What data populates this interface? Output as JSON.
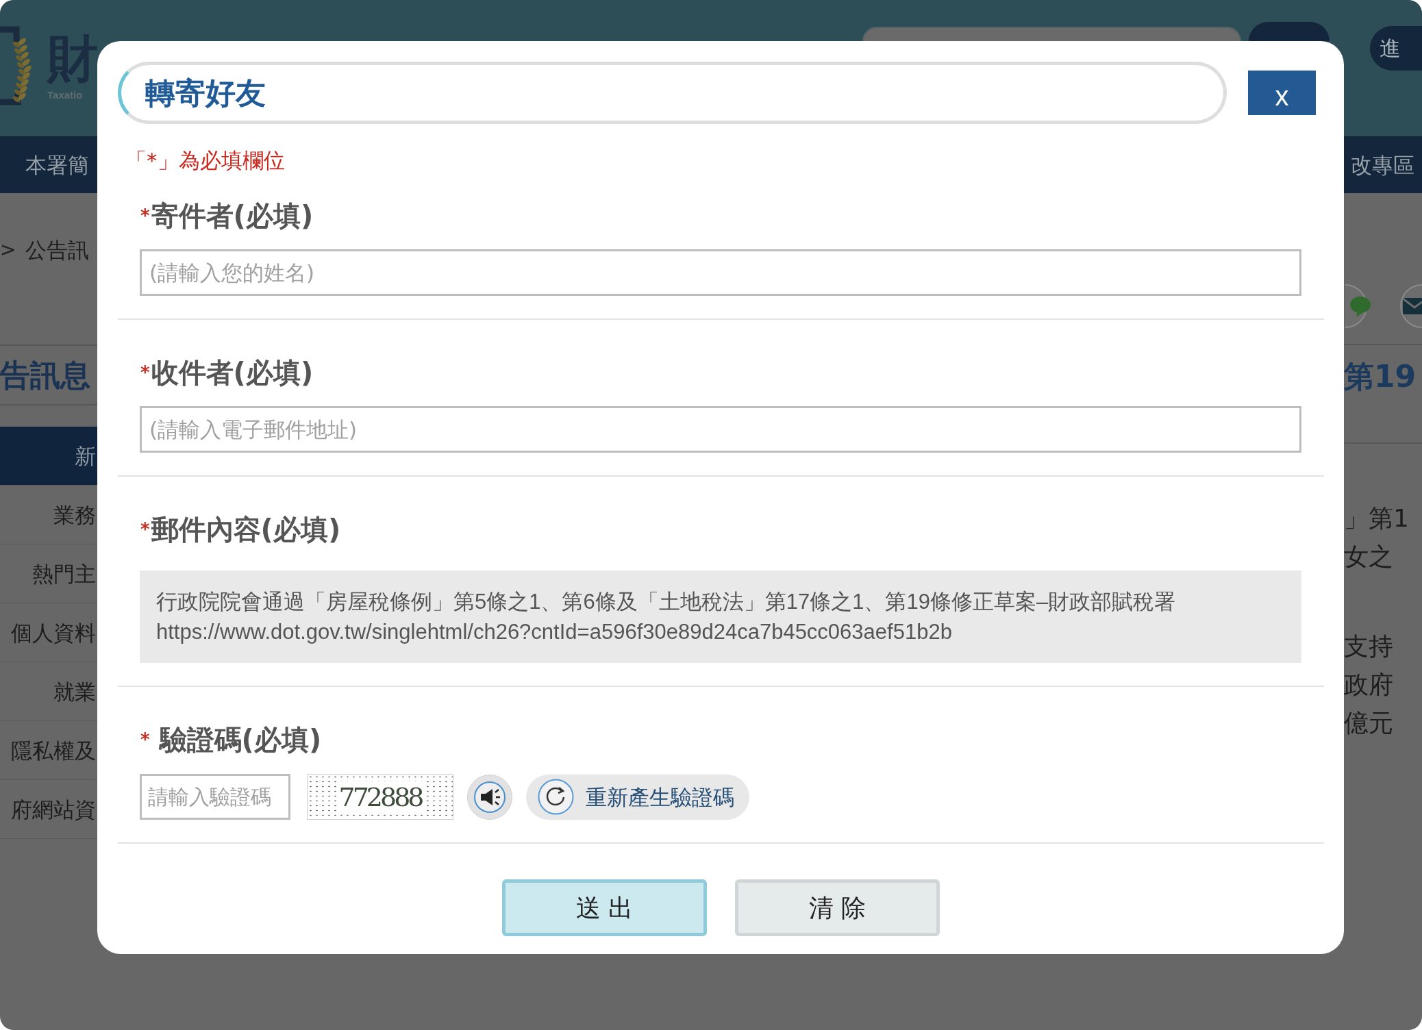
{
  "background_page": {
    "header": {
      "logo_text": "財",
      "logo_subtitle": "Taxatio",
      "right_button": "進"
    },
    "nav_bar": {
      "left_item": "本署簡",
      "right_item": "改專區"
    },
    "breadcrumb": {
      "separator": ">",
      "current": "公告訊"
    },
    "sidebar": {
      "heading": "告訊息",
      "items": [
        {
          "label": "新",
          "selected": true
        },
        {
          "label": "業務",
          "selected": false
        },
        {
          "label": "熱門主",
          "selected": false
        },
        {
          "label": "個人資料",
          "selected": false
        },
        {
          "label": "就業",
          "selected": false
        },
        {
          "label": "隱私權及",
          "selected": false
        },
        {
          "label": "府網站資",
          "selected": false
        }
      ]
    },
    "article": {
      "heading": "第19",
      "paragraphs": [
        [
          "」第1",
          "女之"
        ],
        [
          "支持",
          "政府",
          "億元"
        ]
      ]
    }
  },
  "dialog": {
    "title": "轉寄好友",
    "close_button": "x",
    "required_note": "「*」為必填欄位",
    "fields": [
      {
        "kind": "text",
        "required_mark": "*",
        "label": "寄件者(必填)",
        "placeholder": "(請輸入您的姓名)"
      },
      {
        "kind": "text",
        "required_mark": "*",
        "label": "收件者(必填)",
        "placeholder": "(請輸入電子郵件地址)"
      },
      {
        "kind": "content",
        "required_mark": "*",
        "label": "郵件內容(必填)",
        "value": [
          "行政院院會通過「房屋稅條例」第5條之1、第6條及「土地稅法」第17條之1、第19條修正草案–財政部賦稅署",
          "https://www.dot.gov.tw/singlehtml/ch26?cntId=a596f30e89d24ca7b45cc063aef51b2b"
        ]
      },
      {
        "kind": "captcha",
        "required_mark": "*",
        "label": "驗證碼(必填)",
        "placeholder": "請輸入驗證碼",
        "code": "772888",
        "refresh_button": "重新產生驗證碼"
      }
    ],
    "buttons": [
      {
        "kind": "primary",
        "label": "送 出"
      },
      {
        "kind": "secondary",
        "label": "清 除"
      }
    ]
  }
}
